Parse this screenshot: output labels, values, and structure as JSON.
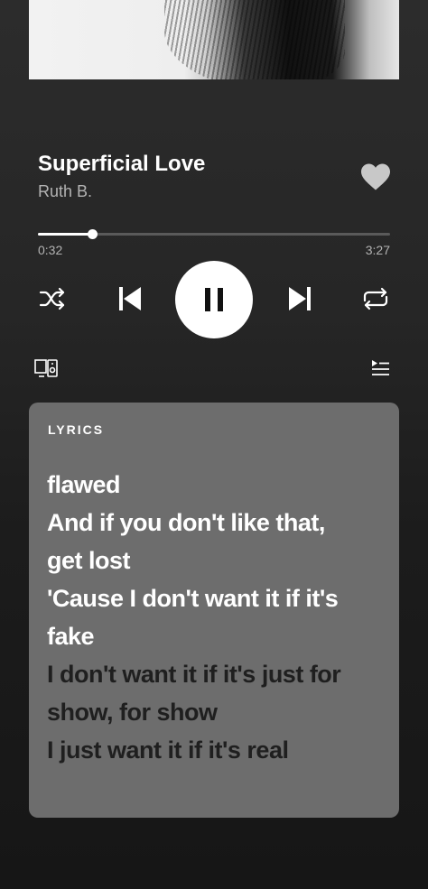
{
  "player": {
    "track_title": "Superficial Love",
    "artist": "Ruth B.",
    "liked": true,
    "progress": {
      "elapsed": "0:32",
      "total": "3:27",
      "fraction": 0.155
    },
    "controls": {
      "shuffle_icon": "shuffle-icon",
      "previous_icon": "skip-previous-icon",
      "play_pause_icon": "pause-icon",
      "next_icon": "skip-next-icon",
      "repeat_icon": "repeat-icon"
    },
    "extras": {
      "devices_icon": "connect-devices-icon",
      "queue_icon": "queue-icon"
    }
  },
  "lyrics": {
    "heading": "LYRICS",
    "lines": [
      {
        "text": "flawed",
        "state": "past"
      },
      {
        "text": "And if you don't like that,",
        "state": "past"
      },
      {
        "text": "get lost",
        "state": "past"
      },
      {
        "text": "'Cause I don't want it if it's",
        "state": "past"
      },
      {
        "text": "fake",
        "state": "past"
      },
      {
        "text": "I don't want it if it's just for",
        "state": "future"
      },
      {
        "text": "show, for show",
        "state": "future"
      },
      {
        "text": "I just want it if it's real",
        "state": "future"
      }
    ]
  },
  "colors": {
    "background": "#262626",
    "lyrics_card": "#6d6d6d",
    "lyric_past": "#ffffff",
    "lyric_future": "#1f1f1f",
    "secondary_text": "#b3b3b3"
  }
}
